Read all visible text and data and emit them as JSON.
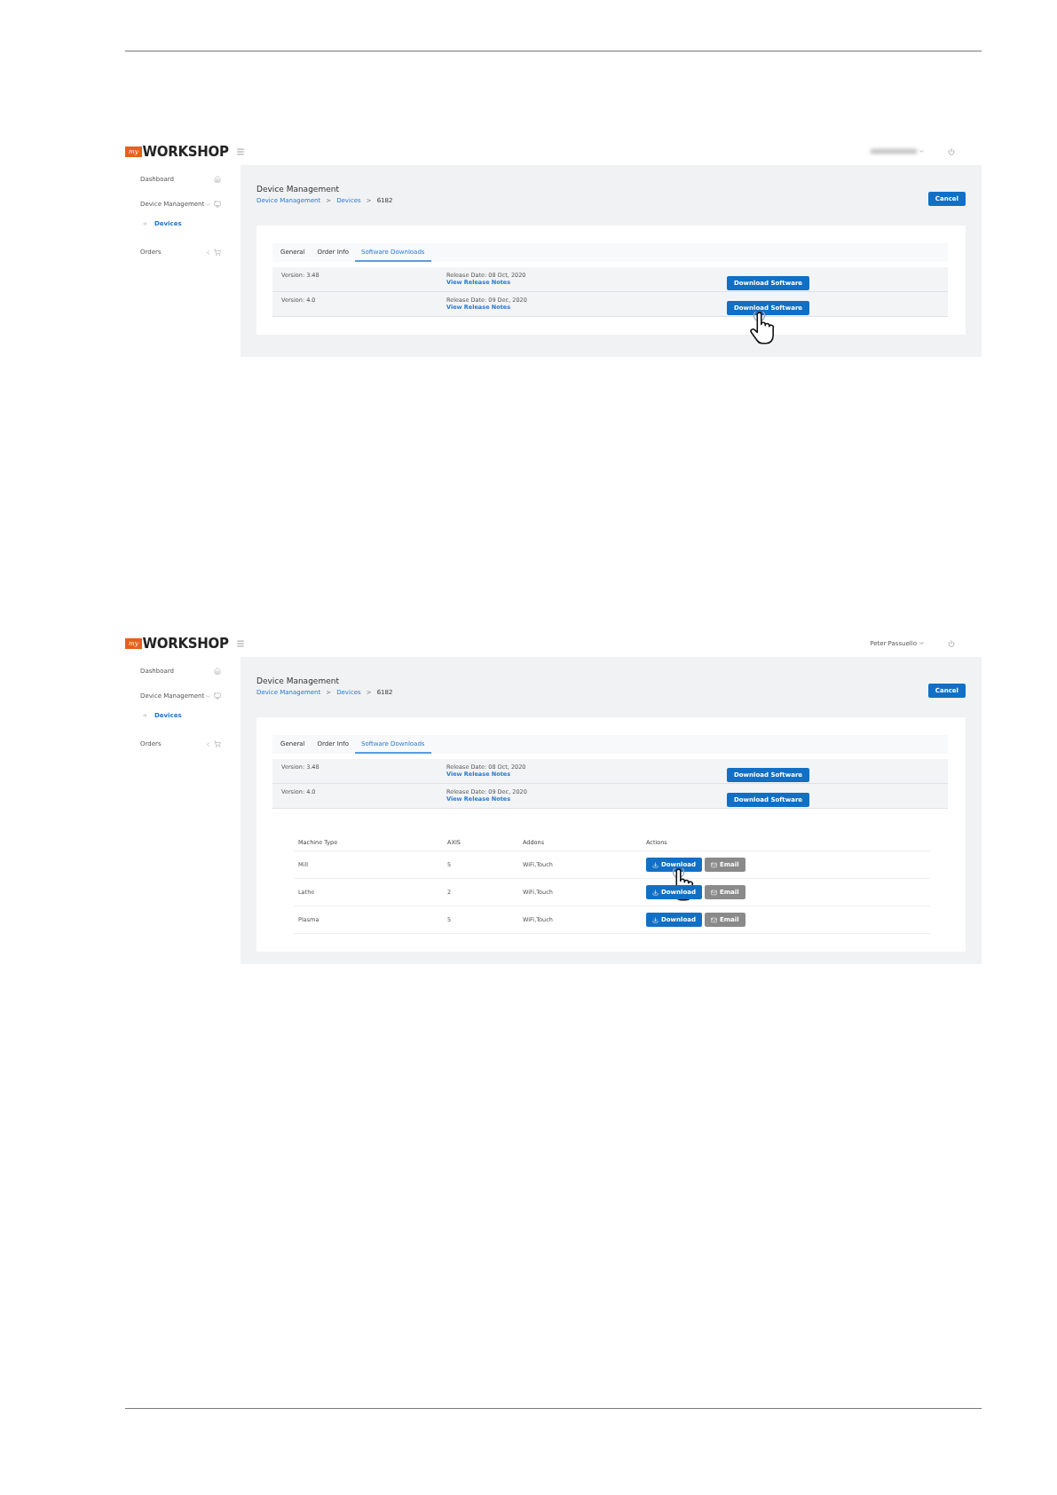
{
  "screenshots": [
    {
      "logo": {
        "badge": "my",
        "name": "WORKSHOP"
      },
      "user": {
        "blurred": true
      },
      "sidebar": [
        {
          "label": "Dashboard"
        },
        {
          "label": "Device Management",
          "expanded": true,
          "children": [
            {
              "label": "Devices",
              "selected": true
            }
          ]
        },
        {
          "label": "Orders",
          "expanded": false
        }
      ],
      "page_title": "Device Management",
      "breadcrumb": [
        {
          "text": "Device Management",
          "link": true
        },
        {
          "text": "Devices",
          "link": true
        },
        {
          "text": "6182",
          "link": false
        }
      ],
      "breadcrumb_separator": ">",
      "cancel": "Cancel",
      "tabs": [
        {
          "label": "General",
          "selected": false
        },
        {
          "label": "Order Info",
          "selected": false
        },
        {
          "label": "Software Downloads",
          "selected": true
        }
      ],
      "versions": [
        {
          "version": "Version: 3.48",
          "release": "Release Date: 08 Oct, 2020",
          "notes": "View Release Notes",
          "button": "Download Software",
          "pointer": false
        },
        {
          "version": "Version: 4.0",
          "release": "Release Date: 09 Dec, 2020",
          "notes": "View Release Notes",
          "button": "Download Software",
          "pointer": true
        }
      ]
    },
    {
      "logo": {
        "badge": "my",
        "name": "WORKSHOP"
      },
      "user": {
        "blurred": false,
        "name": "Peter Passuello"
      },
      "sidebar": [
        {
          "label": "Dashboard"
        },
        {
          "label": "Device Management",
          "expanded": true,
          "children": [
            {
              "label": "Devices",
              "selected": true
            }
          ]
        },
        {
          "label": "Orders",
          "expanded": false
        }
      ],
      "page_title": "Device Management",
      "breadcrumb": [
        {
          "text": "Device Management",
          "link": true
        },
        {
          "text": "Devices",
          "link": true
        },
        {
          "text": "6182",
          "link": false
        }
      ],
      "breadcrumb_separator": ">",
      "cancel": "Cancel",
      "tabs": [
        {
          "label": "General",
          "selected": false
        },
        {
          "label": "Order Info",
          "selected": false
        },
        {
          "label": "Software Downloads",
          "selected": true
        }
      ],
      "versions": [
        {
          "version": "Version: 3.48",
          "release": "Release Date: 08 Oct, 2020",
          "notes": "View Release Notes",
          "button": "Download Software",
          "pointer": false
        },
        {
          "version": "Version: 4.0",
          "release": "Release Date: 09 Dec, 2020",
          "notes": "View Release Notes",
          "button": "Download Software",
          "pointer": false
        }
      ],
      "machines": {
        "columns": [
          "Machine Type",
          "AXIS",
          "Addons",
          "Actions"
        ],
        "rows": [
          {
            "cells": [
              "Mill",
              "5",
              "WiFi,Touch"
            ],
            "download": "Download",
            "email": "Email",
            "email_disabled": true,
            "pointer": true
          },
          {
            "cells": [
              "Lathe",
              "2",
              "WiFi,Touch"
            ],
            "download": "Download",
            "email": "Email",
            "email_disabled": true,
            "pointer": false
          },
          {
            "cells": [
              "Plasma",
              "5",
              "WiFi,Touch"
            ],
            "download": "Download",
            "email": "Email",
            "email_disabled": true,
            "pointer": false
          }
        ]
      }
    }
  ]
}
